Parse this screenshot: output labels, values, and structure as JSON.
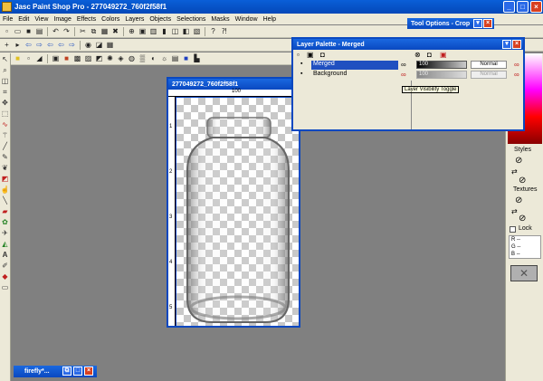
{
  "app": {
    "title": "Jasc Paint Shop Pro - 277049272_760f2f58f1"
  },
  "menu": {
    "items": [
      "File",
      "Edit",
      "View",
      "Image",
      "Effects",
      "Colors",
      "Layers",
      "Objects",
      "Selections",
      "Masks",
      "Window",
      "Help"
    ]
  },
  "tool_options": {
    "title": "Tool Options - Crop"
  },
  "image_window": {
    "title": "277049272_760f2f58f1",
    "ruler_top": "100",
    "ruler_left": [
      "1",
      "2",
      "3",
      "4",
      "5"
    ]
  },
  "layer_palette": {
    "title": "Layer Palette - Merged",
    "layers": [
      {
        "name": "Merged",
        "opacity": "100",
        "blend": "Normal"
      },
      {
        "name": "Background",
        "opacity": "100",
        "blend": "Normal"
      }
    ],
    "tooltip": "Layer Visibility Toggle"
  },
  "right_panel": {
    "styles_label": "Styles",
    "textures_label": "Textures",
    "lock_label": "Lock",
    "r_label": "R",
    "g_label": "G",
    "b_label": "B",
    "r_value": "--",
    "g_value": "--",
    "b_value": "--"
  },
  "minimized": {
    "title": "firefly*..."
  }
}
